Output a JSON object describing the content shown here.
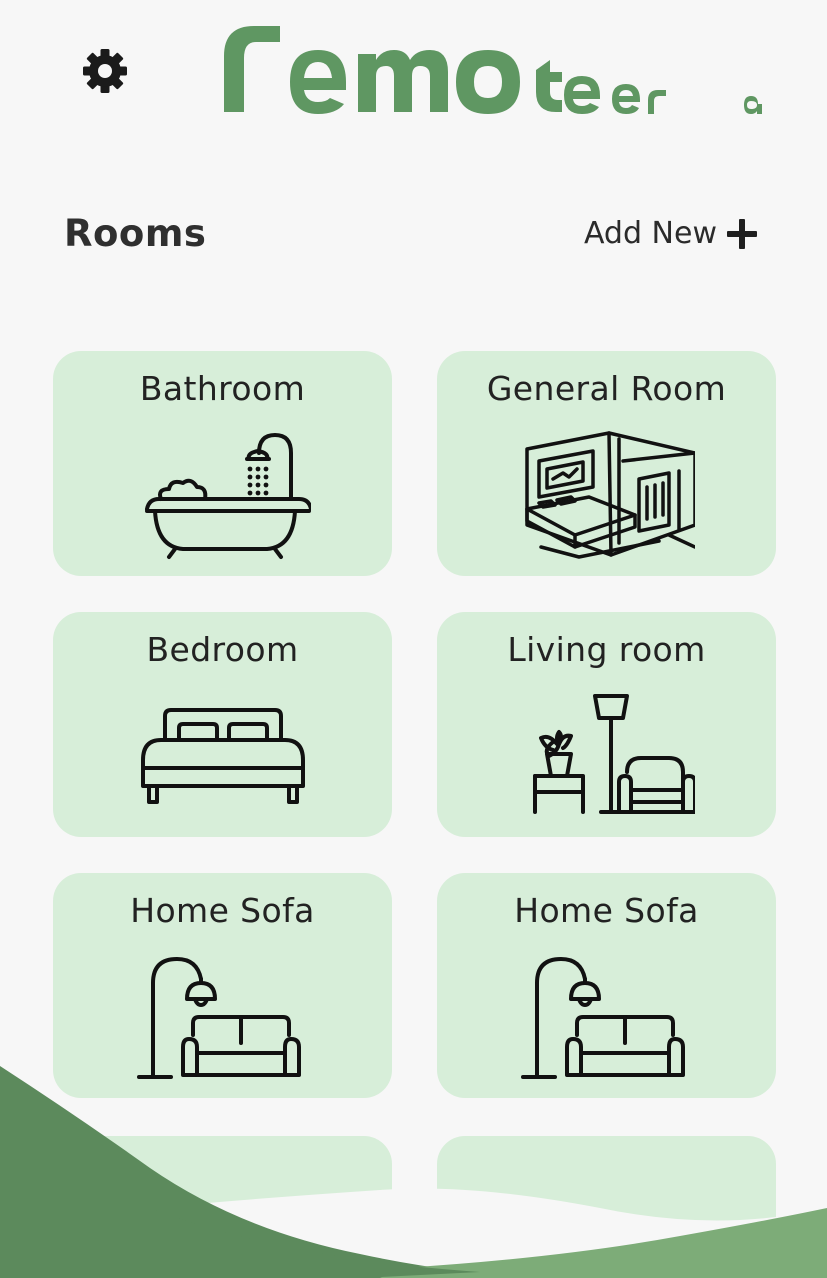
{
  "header": {
    "logo_text": "remoteera",
    "settings_icon": "gear-icon"
  },
  "section": {
    "title": "Rooms",
    "add_new_label": "Add New",
    "add_icon": "plus-icon"
  },
  "rooms": [
    {
      "label": "Bathroom",
      "icon": "bathtub-icon"
    },
    {
      "label": "General Room",
      "icon": "general-room-icon"
    },
    {
      "label": "Bedroom",
      "icon": "bed-icon"
    },
    {
      "label": "Living room",
      "icon": "living-room-icon"
    },
    {
      "label": "Home Sofa",
      "icon": "sofa-lamp-icon"
    },
    {
      "label": "Home Sofa",
      "icon": "sofa-lamp-icon"
    }
  ],
  "colors": {
    "background": "#f7f7f7",
    "card": "#d7eed9",
    "brand_green": "#5f9762",
    "wave_dark": "#5c8a5c",
    "wave_light": "#7dac78"
  }
}
